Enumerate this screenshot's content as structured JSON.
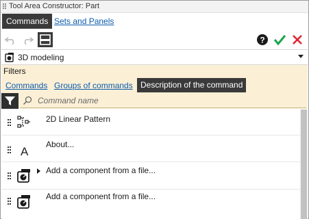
{
  "window": {
    "title": "Tool Area Constructor: Part"
  },
  "tabs": {
    "active_label": "Commands",
    "other_label": "Sets and Panels"
  },
  "toolbar": {
    "undo_icon": "undo-icon",
    "redo_icon": "redo-icon",
    "panel_icon": "panel-layout-icon",
    "help_icon": "help-icon",
    "ok_icon": "checkmark-icon",
    "cancel_icon": "close-icon",
    "ok_color": "#1aa34a",
    "cancel_color": "#e0242f"
  },
  "mode_dropdown": {
    "selected": "3D modeling",
    "icon": "3d-modeling-icon"
  },
  "filters": {
    "label": "Filters",
    "links": [
      "Commands",
      "Groups of commands"
    ],
    "active_link": "Description of the command",
    "search_placeholder": "Command name",
    "search_value": ""
  },
  "commands": [
    {
      "label": "2D Linear Pattern",
      "icon": "linear-pattern-icon",
      "expandable": false
    },
    {
      "label": "About...",
      "icon": "letter-a-icon",
      "expandable": false
    },
    {
      "label": "Add a component from a file...",
      "icon": "component-file-icon",
      "expandable": true
    },
    {
      "label": "Add a component from a file...",
      "icon": "component-file-icon",
      "expandable": false
    }
  ],
  "colors": {
    "accent_dark": "#3a3a3a",
    "filter_bg": "#fbefd6",
    "link": "#0b5cad"
  }
}
